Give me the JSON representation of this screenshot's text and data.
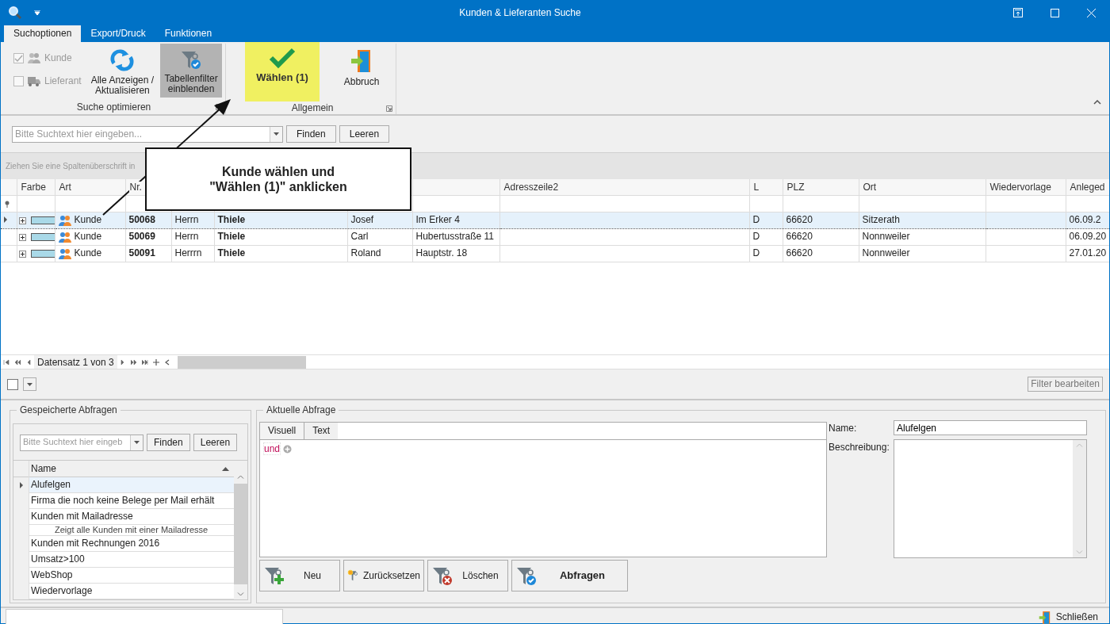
{
  "window": {
    "title": "Kunden & Lieferanten Suche"
  },
  "ribbon_tabs": [
    {
      "label": "Suchoptionen",
      "selected": true
    },
    {
      "label": "Export/Druck",
      "selected": false
    },
    {
      "label": "Funktionen",
      "selected": false
    }
  ],
  "ribbon_groups": [
    {
      "label": "Suche optimieren",
      "checkboxes": [
        {
          "label": "Kunde",
          "checked": true,
          "disabled": true
        },
        {
          "label": "Lieferant",
          "checked": false,
          "disabled": true
        }
      ],
      "buttons": [
        {
          "lines": [
            "Alle Anzeigen /",
            "Aktualisieren"
          ],
          "pressed": false,
          "highlighted": false
        },
        {
          "lines": [
            "Tabellenfilter",
            "einblenden"
          ],
          "pressed": true,
          "highlighted": false
        }
      ]
    },
    {
      "label": "Allgemein",
      "buttons": [
        {
          "lines": [
            "Wählen (1)"
          ],
          "pressed": false,
          "highlighted": true
        },
        {
          "lines": [
            "Abbruch"
          ],
          "pressed": false,
          "highlighted": false
        }
      ]
    }
  ],
  "search": {
    "placeholder": "Bitte Suchtext hier eingeben...",
    "buttons": [
      "Finden",
      "Leeren"
    ]
  },
  "group_panel": "Ziehen Sie eine Spaltenüberschrift in",
  "grid": {
    "columns": {
      "farbe": "Farbe",
      "art": "Art",
      "nr": "Nr.",
      "adresszeile2": "Adresszeile2",
      "l": "L",
      "plz": "PLZ",
      "ort": "Ort",
      "wiedervorlage": "Wiedervorlage",
      "anleged": "Anleged"
    },
    "rows": [
      {
        "selected": true,
        "color": "#a9d9e8",
        "art": "Kunde",
        "nr": "50068",
        "column_4": "Herrn",
        "column_5": "Thiele",
        "column_6": "Josef",
        "column_7": "Im Erker 4",
        "l": "D",
        "plz": "66620",
        "ort": "Sitzerath",
        "anleged": "06.09.2"
      },
      {
        "selected": false,
        "color": "#a9d9e8",
        "art": "Kunde",
        "nr": "50069",
        "column_4": "Herrn",
        "column_5": "Thiele",
        "column_6": "Carl",
        "column_7": "Hubertusstraße 11",
        "l": "D",
        "plz": "66620",
        "ort": "Nonnweiler",
        "anleged": "06.09.20"
      },
      {
        "selected": false,
        "color": "#a9d9e8",
        "art": "Kunde",
        "nr": "50091",
        "column_4": "Herrrn",
        "column_5": "Thiele",
        "column_6": "Roland",
        "column_7": "Hauptstr. 18",
        "l": "D",
        "plz": "66620",
        "ort": "Nonnweiler",
        "anleged": "27.01.20"
      }
    ],
    "navigator": "Datensatz 1 von 3"
  },
  "callout": {
    "lines": [
      "Kunde wählen und",
      "\"Wählen (1)\" anklicken"
    ]
  },
  "filter_bar": {
    "checked": false,
    "button": "Filter bearbeiten"
  },
  "saved_queries": {
    "title": "Gespeicherte Abfragen",
    "placeholder": "Bitte Suchtext hier eingeb",
    "buttons": [
      "Finden",
      "Leeren"
    ],
    "column": "Name",
    "items": [
      {
        "name": "Alufelgen",
        "selected": true
      },
      {
        "name": "Firma die noch keine Belege per Mail erhält",
        "selected": false
      },
      {
        "name": "Kunden mit Mailadresse",
        "selected": false,
        "description": "Zeigt alle Kunden mit einer Mailadresse"
      },
      {
        "name": "Kunden mit Rechnungen 2016",
        "selected": false
      },
      {
        "name": "Umsatz>100",
        "selected": false
      },
      {
        "name": "WebShop",
        "selected": false
      },
      {
        "name": "Wiedervorlage",
        "selected": false
      }
    ]
  },
  "current_query": {
    "title": "Aktuelle Abfrage",
    "tabs": [
      {
        "label": "Visuell",
        "selected": true
      },
      {
        "label": "Text",
        "selected": false
      }
    ],
    "operator": "und",
    "name_label": "Name:",
    "name_value": "Alufelgen",
    "description_label": "Beschreibung:",
    "buttons": [
      {
        "label": "Neu",
        "primary": false
      },
      {
        "label": "Zurücksetzen",
        "primary": false
      },
      {
        "label": "Löschen",
        "primary": false
      },
      {
        "label": "Abfragen",
        "primary": true
      }
    ]
  },
  "status_bar": {
    "close_button": "Schließen"
  }
}
